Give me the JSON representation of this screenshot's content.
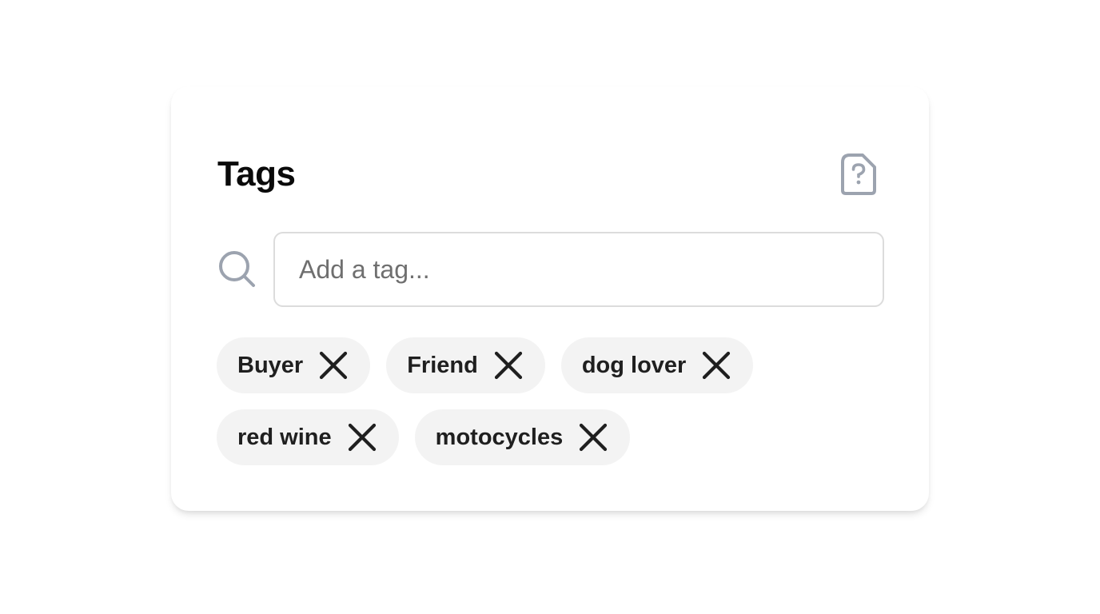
{
  "card": {
    "title": "Tags",
    "help_icon": "file-question-icon"
  },
  "search": {
    "icon": "search-icon",
    "placeholder": "Add a tag...",
    "value": ""
  },
  "tags": [
    {
      "label": "Buyer",
      "remove_icon": "close-icon"
    },
    {
      "label": "Friend",
      "remove_icon": "close-icon"
    },
    {
      "label": "dog lover",
      "remove_icon": "close-icon"
    },
    {
      "label": "red wine",
      "remove_icon": "close-icon"
    },
    {
      "label": "motocycles",
      "remove_icon": "close-icon"
    }
  ],
  "colors": {
    "chip_background": "#f3f3f3",
    "icon_muted": "#9ca3af",
    "text": "#1f1f1f"
  }
}
